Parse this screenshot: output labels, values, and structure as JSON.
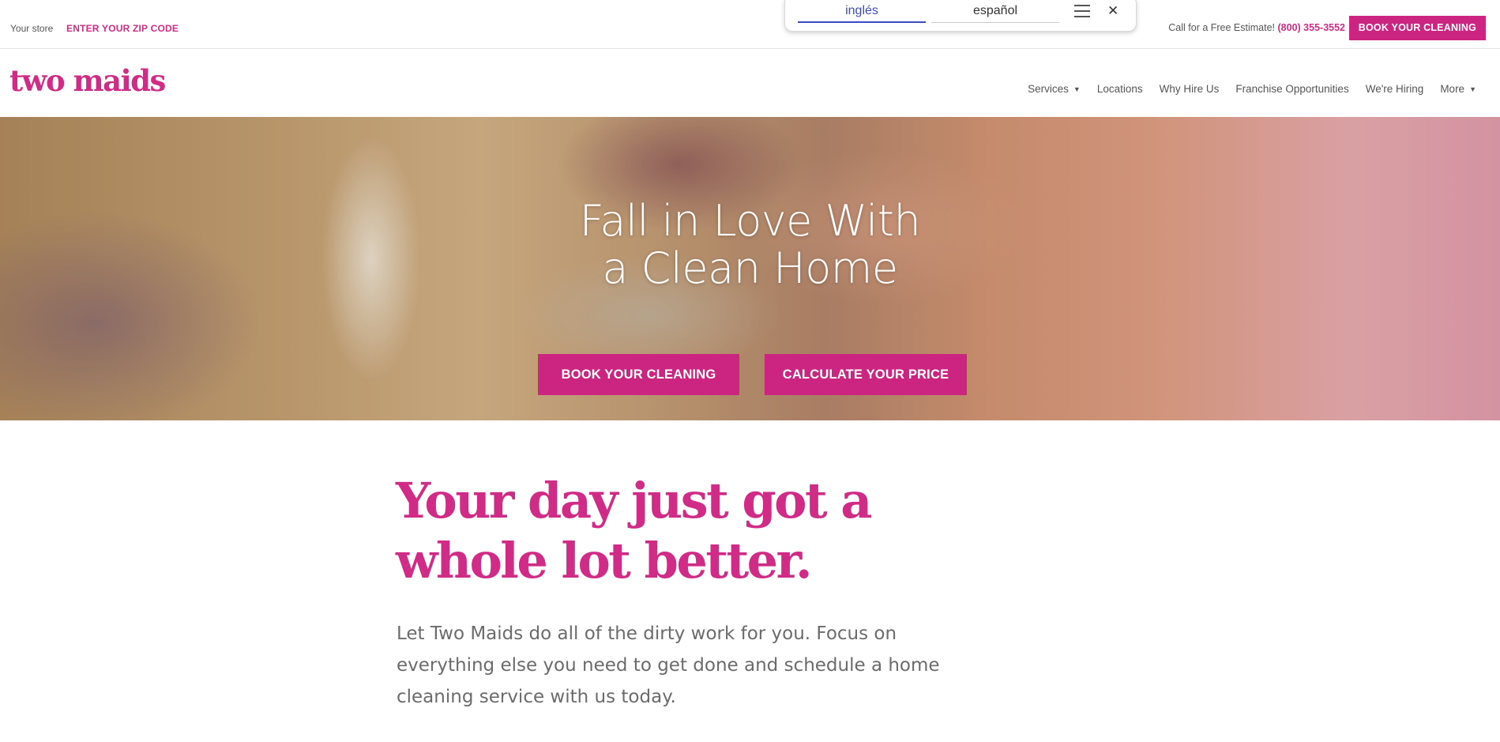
{
  "topbar": {
    "store_label": "Your store",
    "zip_link": "ENTER YOUR ZIP CODE",
    "estimate_text": "Call for a Free Estimate!",
    "phone": "(800) 355-3552",
    "book_button": "BOOK YOUR CLEANING"
  },
  "translate": {
    "languages": [
      "inglés",
      "español"
    ],
    "selected": "inglés",
    "menu_icon": "hamburger-icon",
    "close_icon": "close-icon",
    "close_glyph": "✕"
  },
  "nav": {
    "logo": "two maids",
    "items": [
      {
        "label": "Services",
        "has_dropdown": true
      },
      {
        "label": "Locations",
        "has_dropdown": false
      },
      {
        "label": "Why Hire Us",
        "has_dropdown": false
      },
      {
        "label": "Franchise Opportunities",
        "has_dropdown": false
      },
      {
        "label": "We're Hiring",
        "has_dropdown": false
      },
      {
        "label": "More",
        "has_dropdown": true
      }
    ],
    "caret_glyph": "▼"
  },
  "hero": {
    "title_line1": "Fall in Love With",
    "title_line2": "a Clean Home",
    "book_button": "BOOK YOUR CLEANING",
    "price_button": "CALCULATE YOUR PRICE"
  },
  "intro": {
    "headline_line1": "Your day just got a",
    "headline_line2": "whole lot better.",
    "body": "Let Two Maids do all of the dirty work for you. Focus on everything else you need to get done and schedule a home cleaning service with us today."
  },
  "colors": {
    "brand": "#cc2581",
    "link": "#d02b86",
    "translate_active": "#3b4ac8",
    "text": "#555555"
  }
}
